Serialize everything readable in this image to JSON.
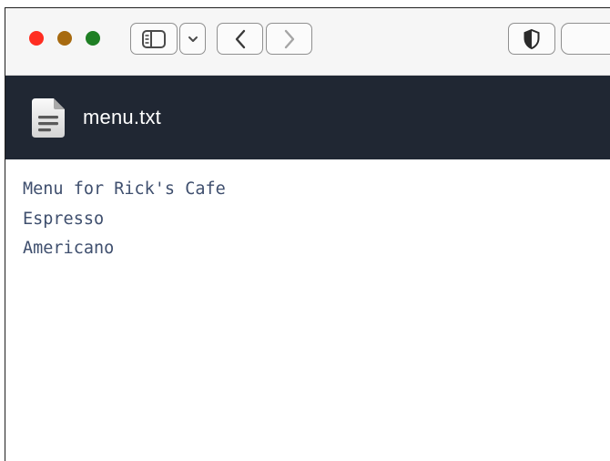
{
  "window": {
    "traffic_lights": [
      {
        "name": "close",
        "color": "#ff2d21"
      },
      {
        "name": "minimize",
        "color": "#a76a10"
      },
      {
        "name": "maximize",
        "color": "#1f7f24"
      }
    ]
  },
  "toolbar": {
    "icons": [
      "sidebar-icon",
      "chevron-down-icon",
      "chevron-left-icon",
      "chevron-right-icon",
      "shield-icon"
    ]
  },
  "tab": {
    "title": "menu.txt",
    "icon": "document-icon"
  },
  "document": {
    "lines": [
      "Menu for Rick's Cafe",
      "Espresso",
      "Americano"
    ]
  },
  "colors": {
    "tab_bar_bg": "#202733",
    "text": "#3f4f6e"
  }
}
